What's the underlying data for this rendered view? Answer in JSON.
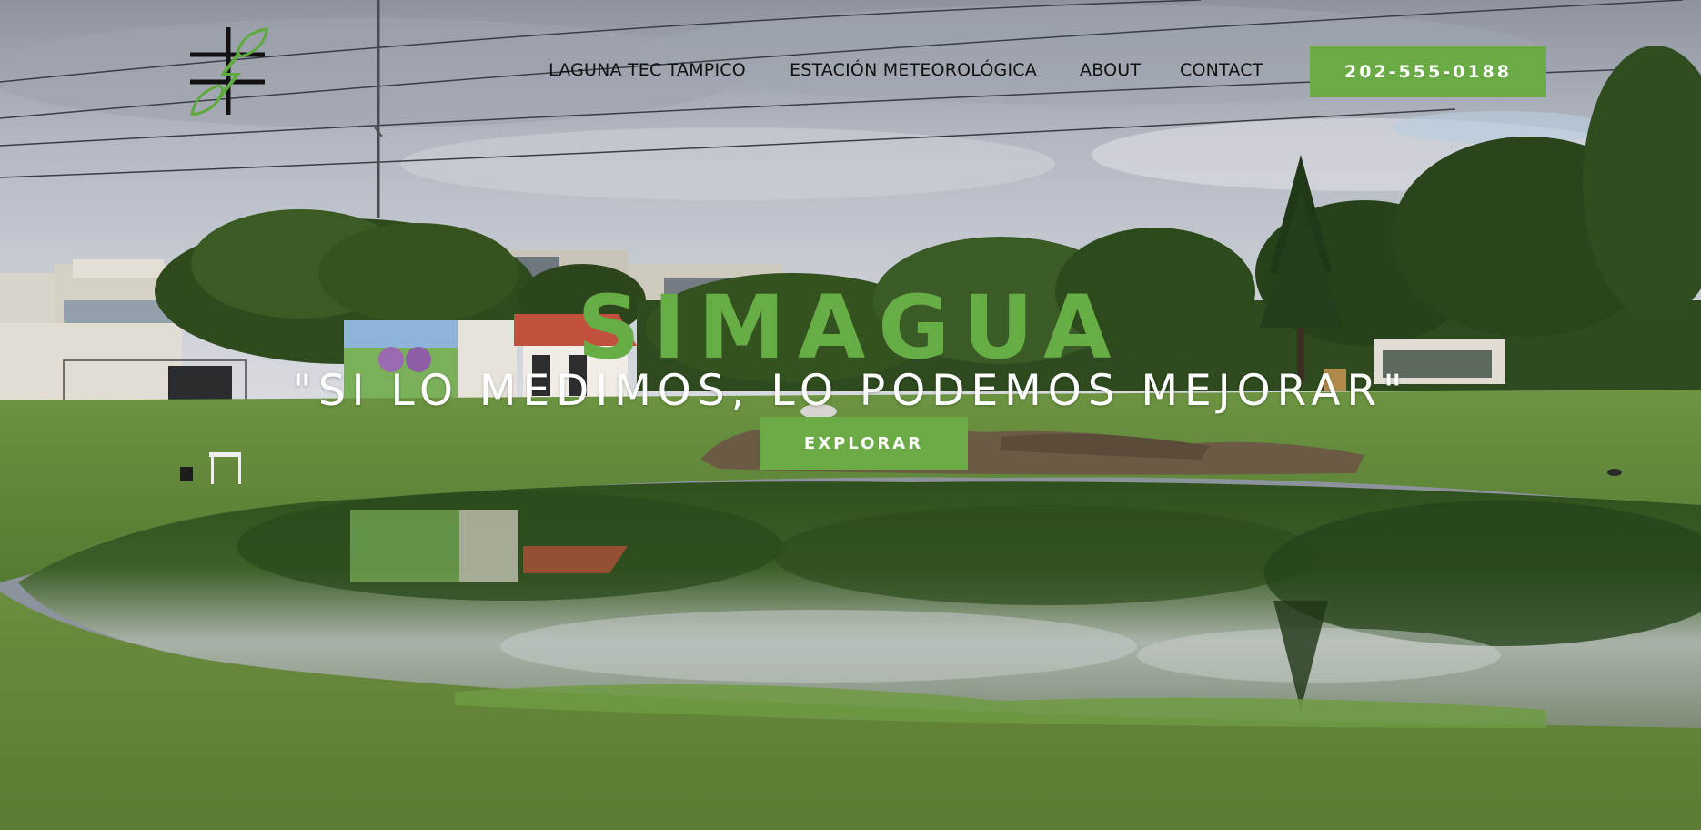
{
  "site": {
    "logo_icon": "leaf-bolt-logo-icon",
    "brand_color": "#6aab45"
  },
  "nav": {
    "items": [
      {
        "label": "LAGUNA TEC TAMPICO"
      },
      {
        "label": "ESTACIÓN METEOROLÓGICA"
      },
      {
        "label": "ABOUT"
      },
      {
        "label": "CONTACT"
      }
    ],
    "phone_label": "202-555-0188"
  },
  "hero": {
    "title": "SIMAGUA",
    "tagline": "\"SI LO MEDIMOS, LO PODEMOS MEJORAR\"",
    "cta_label": "EXPLORAR",
    "title_color": "#66ad45",
    "tagline_color": "#ffffff"
  }
}
